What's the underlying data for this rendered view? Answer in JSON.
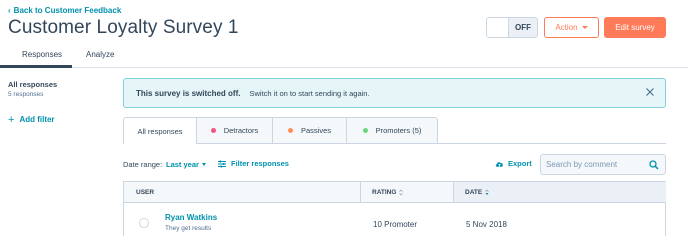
{
  "header": {
    "back_label": "Back to Customer Feedback",
    "title": "Customer Loyalty Survey 1",
    "toggle_label": "OFF",
    "action_label": "Action",
    "edit_label": "Edit survey"
  },
  "tabs": [
    {
      "label": "Responses",
      "active": true
    },
    {
      "label": "Analyze",
      "active": false
    }
  ],
  "sidebar": {
    "heading": "All responses",
    "count": "5 responses",
    "add_filter": "Add filter"
  },
  "banner": {
    "title": "This survey is switched off.",
    "text": "Switch it on to start sending it again."
  },
  "filter_tabs": [
    {
      "label": "All responses"
    },
    {
      "label": "Detractors",
      "color": "#f2547d"
    },
    {
      "label": "Passives",
      "color": "#ff8f59"
    },
    {
      "label": "Promoters (5)",
      "color": "#6cd67a"
    }
  ],
  "toolbar": {
    "date_range_label": "Date range:",
    "date_range_value": "Last year",
    "filter_responses": "Filter responses",
    "export": "Export",
    "search_placeholder": "Search by comment"
  },
  "table": {
    "columns": [
      "USER",
      "RATING",
      "DATE"
    ],
    "rows": [
      {
        "name": "Ryan Watkins",
        "comment": "They get results",
        "rating": "10 Promoter",
        "date": "5 Nov 2018"
      }
    ]
  },
  "colors": {
    "accent": "#ff7a59",
    "link": "#0091ae",
    "text": "#33475b",
    "banner_bg": "#e5f5f8"
  }
}
